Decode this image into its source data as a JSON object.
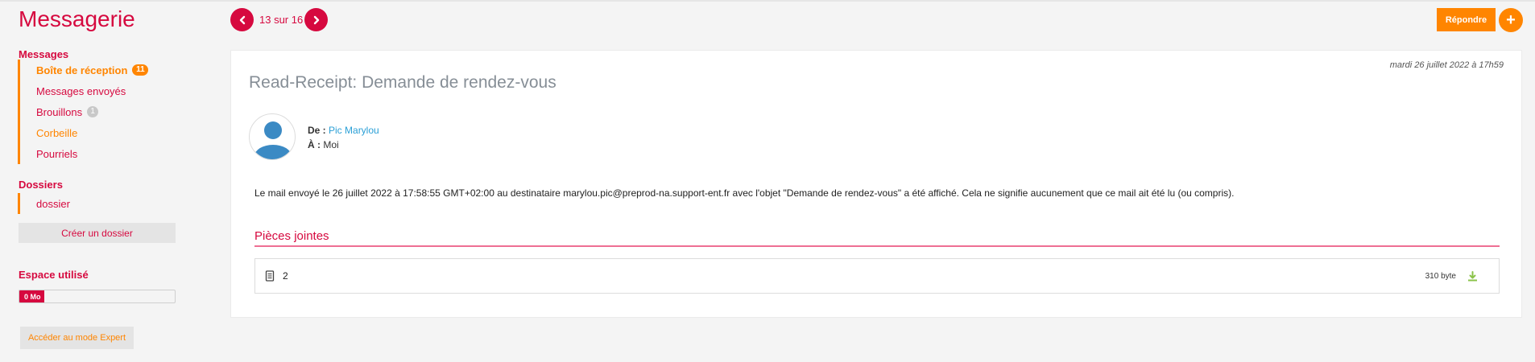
{
  "app": {
    "title": "Messagerie"
  },
  "sidebar": {
    "messages_title": "Messages",
    "items": [
      {
        "label": "Boîte de réception",
        "badge": "11"
      },
      {
        "label": "Messages envoyés"
      },
      {
        "label": "Brouillons",
        "badge": "1"
      },
      {
        "label": "Corbeille"
      },
      {
        "label": "Pourriels"
      }
    ],
    "folders_title": "Dossiers",
    "folders": [
      {
        "label": "dossier"
      }
    ],
    "create_folder": "Créer un dossier",
    "storage_title": "Espace utilisé",
    "storage_value": "0 Mo",
    "storage_fraction": 0.16,
    "expert_mode": "Accéder au mode Expert"
  },
  "pager": {
    "text": "13 sur 16"
  },
  "toolbar": {
    "reply": "Répondre",
    "plus": "+"
  },
  "mail": {
    "date": "mardi 26 juillet 2022 à 17h59",
    "subject": "Read-Receipt: Demande de rendez-vous",
    "from_label": "De :",
    "from_value": "Pic Marylou",
    "to_label": "À :",
    "to_value": "Moi",
    "body": "Le mail envoyé le 26 juillet 2022 à 17:58:55 GMT+02:00 au destinataire marylou.pic@preprod-na.support-ent.fr avec l'objet \"Demande de rendez-vous\" a été affiché. Cela ne signifie aucunement que ce mail ait été lu (ou compris).",
    "attachments_title": "Pièces jointes",
    "attachments": [
      {
        "name": "2",
        "size": "310 byte"
      }
    ]
  },
  "colors": {
    "primary": "#d6093f",
    "accent": "#ff8500",
    "link": "#2a9fd6",
    "download": "#8bc34a"
  }
}
